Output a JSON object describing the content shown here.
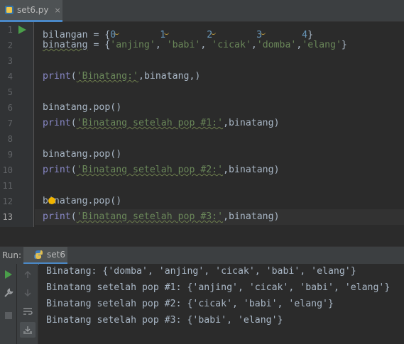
{
  "tab": {
    "label": "set6.py",
    "close": "×"
  },
  "editor": {
    "line_numbers": [
      "1",
      "2",
      "3",
      "4",
      "5",
      "6",
      "7",
      "8",
      "9",
      "10",
      "11",
      "12",
      "13"
    ],
    "code": {
      "l1": {
        "v": "bilangan",
        "eq": " = {",
        "n0": "0",
        "n1": "1",
        "n2": "2",
        "n3": "3",
        "n4": "4",
        "end": "}"
      },
      "l2": {
        "v": "binatang",
        "eq": " = {",
        "s1": "'anjing'",
        "c1": ", ",
        "s2": "'babi'",
        "c2": ", ",
        "s3": "'cicak'",
        "c3": ",",
        "s4": "'domba'",
        "c4": ",",
        "s5": "'elang'",
        "end": "}"
      },
      "l4": {
        "f": "print",
        "p": "(",
        "s": "'Binatang:'",
        "c": ",",
        "v": "binatang",
        "end": ",)"
      },
      "l6": "binatang.pop()",
      "l7": {
        "f": "print",
        "p": "(",
        "s": "'Binatang setelah pop #1:'",
        "c": ",",
        "v": "binatang)"
      },
      "l9": "binatang.pop()",
      "l10": {
        "f": "print",
        "p": "(",
        "s": "'Binatang setelah pop #2:'",
        "c": ",",
        "v": "binatang)"
      },
      "l12": "binatang.pop()",
      "l13": {
        "f": "print",
        "p": "(",
        "s": "'Binatang setelah pop #3:'",
        "c": ",",
        "v": "binatang)"
      }
    }
  },
  "run": {
    "title": "Run:",
    "tab_label": "set6",
    "output": [
      "Binatang: {'domba', 'anjing', 'cicak', 'babi', 'elang'}",
      "Binatang setelah pop #1: {'anjing', 'cicak', 'babi', 'elang'}",
      "Binatang setelah pop #2: {'cicak', 'babi', 'elang'}",
      "Binatang setelah pop #3: {'babi', 'elang'}"
    ]
  },
  "colors": {
    "keyword_builtin": "#8888c6",
    "string": "#6a8759",
    "number": "#6897bb",
    "text": "#a9b7c6",
    "run_green": "#4a9e4a",
    "accent": "#4a88c7"
  },
  "icons": [
    "python-file-icon",
    "run-arrow-icon",
    "lightbulb-icon",
    "python-icon",
    "play-icon",
    "up-arrow-icon",
    "down-arrow-icon",
    "wrench-icon",
    "stop-icon",
    "soft-wrap-icon",
    "scroll-to-end-icon"
  ]
}
